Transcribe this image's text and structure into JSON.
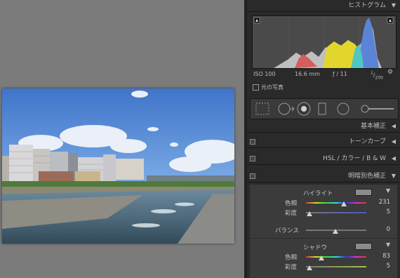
{
  "histogram": {
    "title": "ヒストグラム",
    "iso": "ISO 100",
    "focal": "16.6 mm",
    "aperture": "ƒ / 11",
    "shutter_num": "1",
    "shutter_den": "200",
    "original_photo": "元の写真"
  },
  "panels": {
    "basic": "基本補正",
    "tone_curve": "トーンカーブ",
    "hsl": "HSL / カラー / B & W",
    "split_toning": "明暗別色補正"
  },
  "split_toning": {
    "highlights": {
      "label": "ハイライト",
      "hue_label": "色相",
      "hue": "231",
      "sat_label": "彩度",
      "sat": "5",
      "swatch": "#8c8c8c"
    },
    "balance": {
      "label": "バランス",
      "value": "0"
    },
    "shadows": {
      "label": "シャドウ",
      "hue_label": "色相",
      "hue": "83",
      "sat_label": "彩度",
      "sat": "5",
      "swatch": "#8c8c8c"
    }
  },
  "colors": {
    "panel_bg": "#2a2a2a",
    "canvas_bg": "#7b7b7b",
    "text": "#bdbdbd"
  }
}
